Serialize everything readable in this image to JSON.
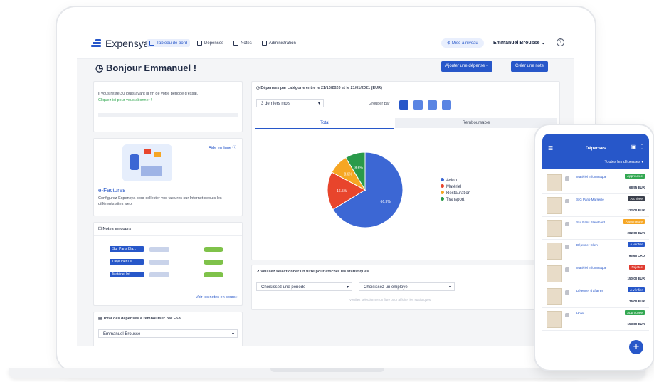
{
  "app": {
    "name": "Expensya"
  },
  "nav": [
    {
      "label": "Tableau de bord",
      "active": true
    },
    {
      "label": "Dépenses",
      "active": false
    },
    {
      "label": "Notes",
      "active": false
    },
    {
      "label": "Administration",
      "active": false
    }
  ],
  "header": {
    "upgrade": "Mise à niveau",
    "user": "Emmanuel Brousse",
    "greeting": "Bonjour Emmanuel !",
    "add_expense": "Ajouter une dépense",
    "create_note": "Créer une note"
  },
  "trial": {
    "text": "Il vous reste 30 jours avant la fin de votre période d'essai.",
    "link": "Cliquez ici pour vous abonner !"
  },
  "efactures": {
    "help": "Aide en ligne",
    "title": "e-Factures",
    "desc": "Configurez Expensya pour collecter vos factures sur Internet depuis les différents sites web."
  },
  "notes": {
    "title": "Notes en cours",
    "rows": [
      "Sur Paris Bla...",
      "Déjeuner Cli...",
      "Matériel Inf..."
    ],
    "link": "Voir les notes en cours"
  },
  "reimburse": {
    "title": "Total des dépenses à rembourser par FSK",
    "select": "Emmanuel Brousse"
  },
  "chart_panel": {
    "title": "Dépenses par catégorie entre le 21/10/2020 et le 21/01/2021 (EUR)",
    "period": "3 derniers mois",
    "group_label": "Grouper par",
    "tab_total": "Total",
    "tab_refund": "Remboursable"
  },
  "chart_data": {
    "type": "pie",
    "categories": [
      "Avion",
      "Matériel",
      "Restauration",
      "Transport"
    ],
    "values": [
      66.3,
      16.5,
      8.6,
      8.6
    ],
    "colors": [
      "#3c67d4",
      "#e8452c",
      "#f6a623",
      "#2a9a4a"
    ],
    "legend": "right"
  },
  "filter": {
    "title": "Veuillez sélectionner un filtre pour afficher les statistiques",
    "period": "Choisissez une période",
    "employee": "Choisissez un employé",
    "hint": "Veuillez sélectionner un filtre pour afficher les statistiques"
  },
  "phone": {
    "title": "Dépenses",
    "sub": "Toutes les dépenses",
    "items": [
      {
        "name": "Matériel Informatique",
        "status": "Approuvée",
        "status_color": "#33a852",
        "amount": "68.55 EUR"
      },
      {
        "name": "SIG Paris-Marseille",
        "status": "Archivée",
        "status_color": "#3a3f4b",
        "amount": "122.00 EUR"
      },
      {
        "name": "Sur Paris Blanchard",
        "status": "À soumettre",
        "status_color": "#f6a623",
        "amount": "282.00 EUR"
      },
      {
        "name": "Déjeuner Client",
        "status": "À vérifier",
        "status_color": "#2757c9",
        "amount": "96.65 CAD"
      },
      {
        "name": "Matériel Informatique",
        "status": "Rejetée",
        "status_color": "#e03b2f",
        "amount": "150.00 EUR"
      },
      {
        "name": "Déjeuner d'affaires",
        "status": "À vérifier",
        "status_color": "#2757c9",
        "amount": "75.00 EUR"
      },
      {
        "name": "Hotel",
        "status": "Approuvée",
        "status_color": "#33a852",
        "amount": "153.80 EUR"
      }
    ]
  }
}
